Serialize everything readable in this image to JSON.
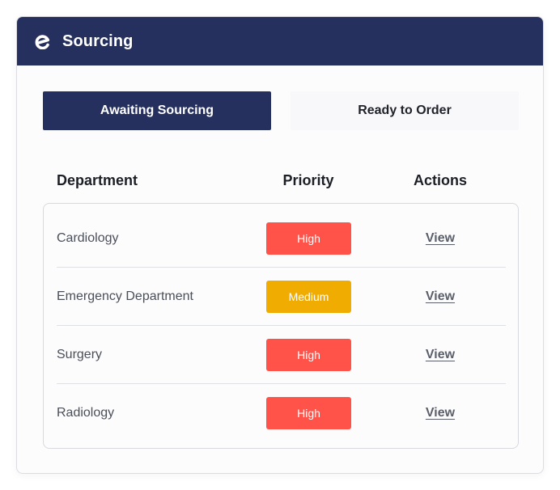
{
  "header": {
    "title": "Sourcing",
    "color": "#25305e"
  },
  "tabs": [
    {
      "label": "Awaiting Sourcing",
      "active": true
    },
    {
      "label": "Ready to Order",
      "active": false
    }
  ],
  "table": {
    "columns": [
      "Department",
      "Priority",
      "Actions"
    ],
    "rows": [
      {
        "department": "Cardiology",
        "priority": "High",
        "priority_color": "#ff5349",
        "action": "View"
      },
      {
        "department": "Emergency Department",
        "priority": "Medium",
        "priority_color": "#f0ac00",
        "action": "View"
      },
      {
        "department": "Surgery",
        "priority": "High",
        "priority_color": "#ff5349",
        "action": "View"
      },
      {
        "department": "Radiology",
        "priority": "High",
        "priority_color": "#ff5349",
        "action": "View"
      }
    ]
  },
  "icons": {
    "logo": "brand-e-logo-icon"
  }
}
